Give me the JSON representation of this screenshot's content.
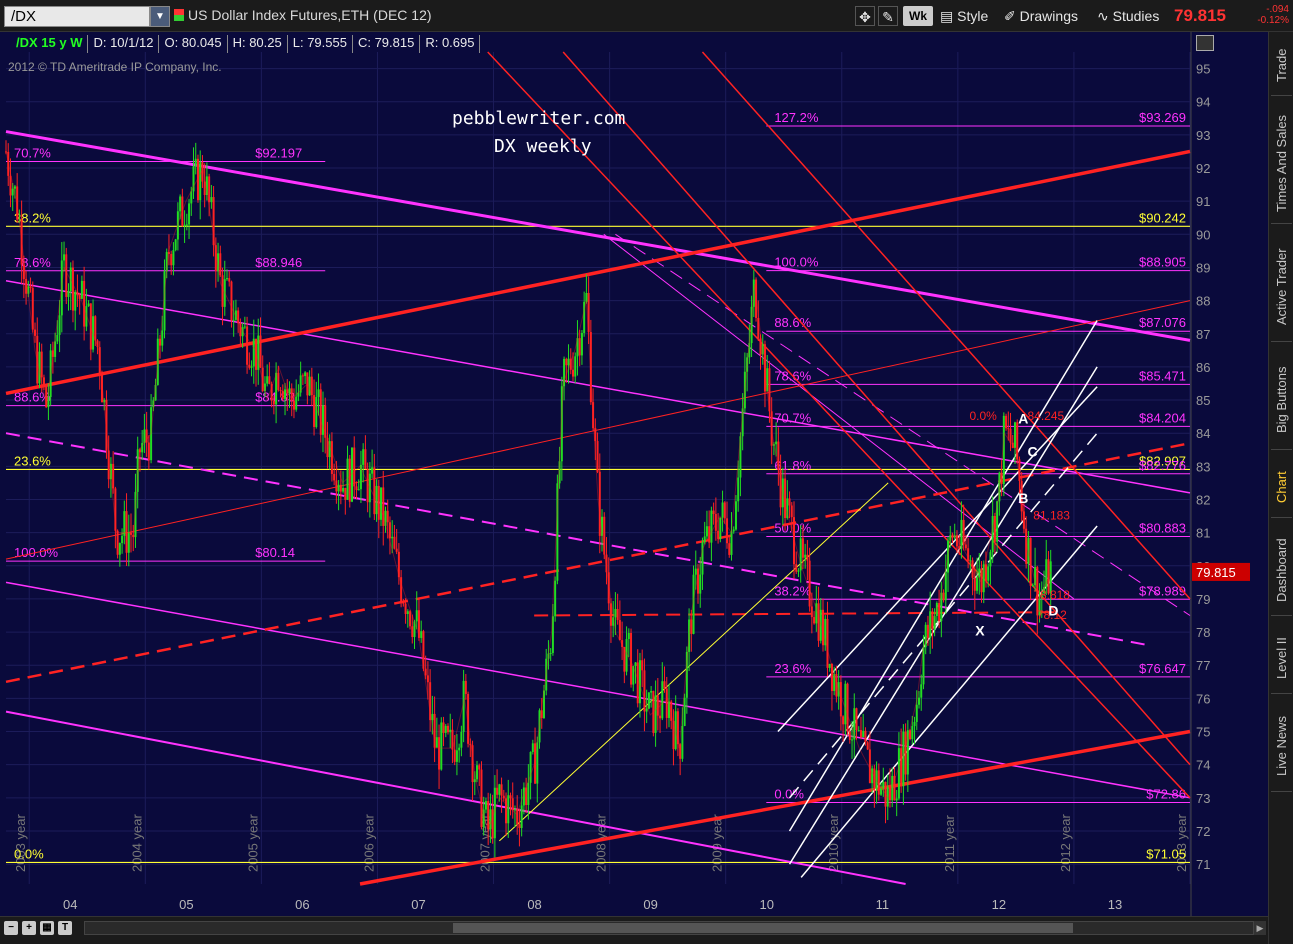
{
  "toolbar": {
    "symbol": "/DX",
    "instrument_title": "US Dollar Index Futures,ETH (DEC 12)",
    "period_button": "Wk",
    "style_label": "Style",
    "drawings_label": "Drawings",
    "studies_label": "Studies",
    "last_price": "79.815",
    "net_change": "-.094",
    "pct_change": "-0.12%"
  },
  "info": {
    "symbol_period": "/DX 15 y W",
    "date": "D: 10/1/12",
    "open": "O: 80.045",
    "high": "H: 80.25",
    "low": "L: 79.555",
    "close": "C: 79.815",
    "range": "R: 0.695"
  },
  "copyright": "2012 © TD Ameritrade IP Company, Inc.",
  "watermark": {
    "site": "pebblewriter.com",
    "subtitle": "DX weekly"
  },
  "sidebar": {
    "tabs": [
      "Trade",
      "Times And Sales",
      "Active Trader",
      "Big Buttons",
      "Chart",
      "Dashboard",
      "Level II",
      "Live News"
    ],
    "active": "Chart"
  },
  "colors": {
    "background": "#0a0a3c",
    "up_candle": "#22dd22",
    "down_candle": "#ff2222",
    "magenta": "#ff33ff",
    "red": "#ff2222",
    "yellow": "#ffff33",
    "white": "#ffffff"
  },
  "chart_data": {
    "type": "line",
    "y_axis_ticks": [
      71,
      72,
      73,
      74,
      75,
      76,
      77,
      78,
      79,
      80,
      81,
      82,
      83,
      84,
      85,
      86,
      87,
      88,
      89,
      90,
      91,
      92,
      93,
      94,
      95
    ],
    "ylim": [
      70.4,
      95.5
    ],
    "x_axis_ticks": [
      "04",
      "05",
      "06",
      "07",
      "08",
      "09",
      "10",
      "11",
      "12",
      "13"
    ],
    "year_labels": [
      "2003 year",
      "2004 year",
      "2005 year",
      "2006 year",
      "2007 year",
      "2008 year",
      "2009 year",
      "2010 year",
      "2011 year",
      "2012 year",
      "2013 year"
    ],
    "xlim": [
      2003.75,
      2013.95
    ],
    "current_price_label": "79.815",
    "price_series": {
      "name": "/DX",
      "x": [
        2003.75,
        2003.85,
        2004.0,
        2004.1,
        2004.25,
        2004.4,
        2004.55,
        2004.7,
        2004.85,
        2004.9,
        2005.0,
        2005.15,
        2005.3,
        2005.45,
        2005.6,
        2005.8,
        2005.9,
        2006.0,
        2006.1,
        2006.2,
        2006.35,
        2006.5,
        2006.65,
        2006.8,
        2007.0,
        2007.15,
        2007.3,
        2007.45,
        2007.6,
        2007.7,
        2007.8,
        2007.9,
        2008.0,
        2008.15,
        2008.3,
        2008.45,
        2008.55,
        2008.65,
        2008.75,
        2008.85,
        2008.9,
        2009.0,
        2009.15,
        2009.3,
        2009.45,
        2009.55,
        2009.65,
        2009.75,
        2009.9,
        2010.0,
        2010.2,
        2010.35,
        2010.45,
        2010.6,
        2010.75,
        2010.9,
        2011.0,
        2011.1,
        2011.25,
        2011.35,
        2011.5,
        2011.6,
        2011.65,
        2011.8,
        2011.9,
        2012.0,
        2012.15,
        2012.3,
        2012.35,
        2012.45,
        2012.55,
        2012.65,
        2012.75
      ],
      "values": [
        92.5,
        90.8,
        86.5,
        84.8,
        89.0,
        88.0,
        86.5,
        81.0,
        81.0,
        83.5,
        84.0,
        89.5,
        91.0,
        92.0,
        88.5,
        87.0,
        86.5,
        85.0,
        86.0,
        85.0,
        85.5,
        84.0,
        82.5,
        83.0,
        81.5,
        79.5,
        78.0,
        74.5,
        74.5,
        76.0,
        73.5,
        72.0,
        73.0,
        72.5,
        74.0,
        78.0,
        85.5,
        86.5,
        88.0,
        82.0,
        80.5,
        78.0,
        77.0,
        75.5,
        76.0,
        74.5,
        78.5,
        80.5,
        81.5,
        81.0,
        88.5,
        84.0,
        82.0,
        80.0,
        78.5,
        76.5,
        75.5,
        74.5,
        73.5,
        73.0,
        74.5,
        76.0,
        77.5,
        79.0,
        81.0,
        80.5,
        79.5,
        82.0,
        84.0,
        83.5,
        80.5,
        79.0,
        79.815
      ]
    },
    "lines": [
      {
        "color": "magenta",
        "width": 3,
        "x": [
          2003.75,
          2013.95
        ],
        "y": [
          93.1,
          86.8
        ]
      },
      {
        "color": "magenta",
        "width": 1.5,
        "x": [
          2003.75,
          2013.95
        ],
        "y": [
          88.6,
          82.2
        ]
      },
      {
        "color": "magenta",
        "width": 2,
        "dash": true,
        "x": [
          2003.75,
          2013.6
        ],
        "y": [
          84.0,
          77.6
        ]
      },
      {
        "color": "magenta",
        "width": 1.5,
        "x": [
          2003.75,
          2013.95
        ],
        "y": [
          79.5,
          73.0
        ]
      },
      {
        "color": "magenta",
        "width": 2,
        "x": [
          2003.75,
          2011.5
        ],
        "y": [
          75.6,
          70.4
        ]
      },
      {
        "color": "magenta",
        "width": 1,
        "x": [
          2008.9,
          2012.95
        ],
        "y": [
          90.0,
          79.0
        ]
      },
      {
        "color": "magenta",
        "width": 1,
        "dash": true,
        "x": [
          2009.0,
          2013.95
        ],
        "y": [
          90.0,
          78.5
        ]
      },
      {
        "color": "red",
        "width": 3.5,
        "x": [
          2003.75,
          2013.95
        ],
        "y": [
          85.2,
          92.5
        ]
      },
      {
        "color": "red",
        "width": 3.5,
        "x": [
          2006.8,
          2013.95
        ],
        "y": [
          70.4,
          75.0
        ]
      },
      {
        "color": "red",
        "width": 2.5,
        "dash": true,
        "x": [
          2003.75,
          2013.95
        ],
        "y": [
          76.5,
          83.7
        ]
      },
      {
        "color": "red",
        "width": 1,
        "x": [
          2003.75,
          2013.95
        ],
        "y": [
          80.2,
          88.0
        ]
      },
      {
        "color": "red",
        "width": 1.5,
        "x": [
          2007.9,
          2013.95
        ],
        "y": [
          95.5,
          73.0
        ]
      },
      {
        "color": "red",
        "width": 1.5,
        "x": [
          2008.55,
          2013.95
        ],
        "y": [
          95.5,
          74.0
        ]
      },
      {
        "color": "red",
        "width": 1.5,
        "x": [
          2009.75,
          2013.95
        ],
        "y": [
          95.5,
          79.0
        ]
      },
      {
        "color": "red",
        "width": 2,
        "dash": true,
        "x": [
          2008.3,
          2012.8
        ],
        "y": [
          78.5,
          78.6
        ]
      },
      {
        "color": "yellow",
        "width": 1,
        "x": [
          2008.0,
          2011.35
        ],
        "y": [
          71.7,
          82.5
        ]
      },
      {
        "color": "white",
        "width": 1.5,
        "x": [
          2010.5,
          2013.15
        ],
        "y": [
          72.0,
          87.4
        ]
      },
      {
        "color": "white",
        "width": 1.5,
        "x": [
          2010.5,
          2013.15
        ],
        "y": [
          71.0,
          86.0
        ]
      },
      {
        "color": "white",
        "width": 1.5,
        "dash": true,
        "x": [
          2010.5,
          2013.15
        ],
        "y": [
          73.0,
          84.0
        ]
      },
      {
        "color": "white",
        "width": 1.5,
        "x": [
          2010.6,
          2013.15
        ],
        "y": [
          70.6,
          81.2
        ]
      },
      {
        "color": "white",
        "width": 1.5,
        "x": [
          2010.4,
          2013.15
        ],
        "y": [
          75.0,
          85.4
        ]
      }
    ],
    "hlines": [
      {
        "y": 93.269,
        "color": "magenta",
        "label_left": "127.2%",
        "label_right": "$93.269",
        "x_start": 2010.3
      },
      {
        "y": 92.197,
        "color": "magenta",
        "label_left": "70.7%",
        "label_mid": "$92.197",
        "x_start": 2003.75,
        "x_end": 2006.5
      },
      {
        "y": 90.242,
        "color": "yellow",
        "label_left": "38.2%",
        "label_right": "$90.242",
        "x_start": 2003.75
      },
      {
        "y": 88.905,
        "color": "magenta",
        "label_left": "100.0%",
        "label_right": "$88.905",
        "x_start": 2010.3
      },
      {
        "y": 88.9,
        "color": "magenta",
        "label_left": "78.6%",
        "label_mid": "$88.946",
        "x_start": 2003.75,
        "x_end": 2006.5
      },
      {
        "y": 87.076,
        "color": "magenta",
        "label_left": "88.6%",
        "label_right": "$87.076",
        "x_start": 2010.3
      },
      {
        "y": 85.471,
        "color": "magenta",
        "label_left": "78.6%",
        "label_right": "$85.471",
        "x_start": 2010.3
      },
      {
        "y": 84.83,
        "color": "magenta",
        "label_left": "88.6%",
        "label_mid": "$84.83",
        "x_start": 2003.75,
        "x_end": 2006.5
      },
      {
        "y": 84.204,
        "color": "magenta",
        "label_left": "70.7%",
        "label_right": "$84.204",
        "x_start": 2010.3
      },
      {
        "y": 82.907,
        "color": "yellow",
        "label_left": "23.6%",
        "label_right": "$82.907",
        "x_start": 2003.75
      },
      {
        "y": 82.776,
        "color": "magenta",
        "label_left": "61.8%",
        "label_right": "$82.776",
        "x_start": 2010.3
      },
      {
        "y": 80.883,
        "color": "magenta",
        "label_left": "50.0%",
        "label_right": "$80.883",
        "x_start": 2010.3
      },
      {
        "y": 80.14,
        "color": "magenta",
        "label_left": "100.0%",
        "label_mid": "$80.14",
        "x_start": 2003.75,
        "x_end": 2006.5
      },
      {
        "y": 78.989,
        "color": "magenta",
        "label_left": "38.2%",
        "label_right": "$78.989",
        "x_start": 2010.3
      },
      {
        "y": 76.647,
        "color": "magenta",
        "label_left": "23.6%",
        "label_right": "$76.647",
        "x_start": 2010.3
      },
      {
        "y": 72.86,
        "color": "magenta",
        "label_left": "0.0%",
        "label_right": "$72.86",
        "x_start": 2010.3
      },
      {
        "y": 71.05,
        "color": "yellow",
        "label_left": "0.0%",
        "label_right": "$71.05",
        "x_start": 2003.75
      }
    ],
    "pattern_points": [
      {
        "label": "A",
        "x": 2012.47,
        "y": 84.3
      },
      {
        "label": "C",
        "x": 2012.55,
        "y": 83.3
      },
      {
        "label": "B",
        "x": 2012.47,
        "y": 81.9
      },
      {
        "label": "X",
        "x": 2012.1,
        "y": 77.9
      },
      {
        "label": "D",
        "x": 2012.73,
        "y": 78.5
      }
    ],
    "pattern_labels": [
      {
        "text": "0.0%",
        "x": 2012.05,
        "y": 84.4
      },
      {
        "text": "84.245",
        "x": 2012.55,
        "y": 84.4
      },
      {
        "text": "81.183",
        "x": 2012.6,
        "y": 81.4
      },
      {
        "text": "78.818",
        "x": 2012.6,
        "y": 79.0
      },
      {
        "text": "78.12",
        "x": 2012.63,
        "y": 78.4
      }
    ]
  }
}
